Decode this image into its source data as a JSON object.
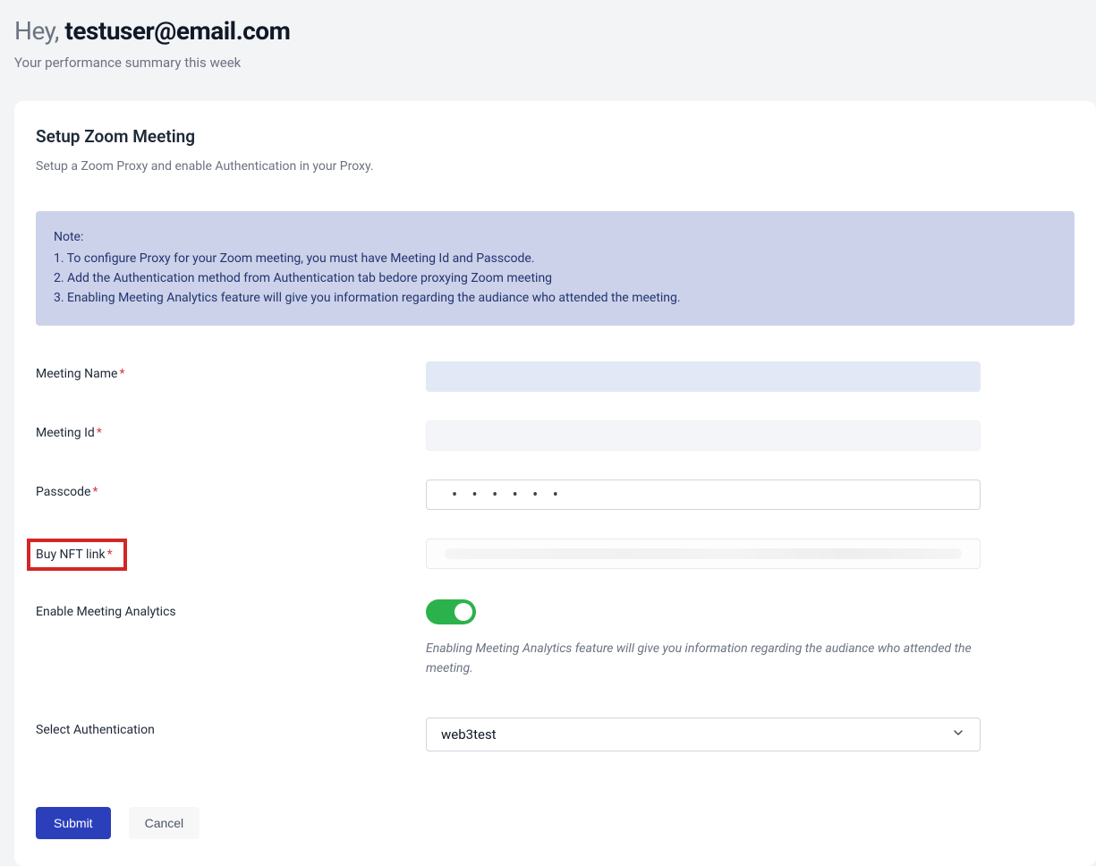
{
  "header": {
    "greeting_prefix": "Hey, ",
    "email": "testuser@email.com",
    "subtitle": "Your performance summary this week"
  },
  "card": {
    "title": "Setup Zoom Meeting",
    "description": "Setup a Zoom Proxy and enable Authentication in your Proxy.",
    "note": {
      "label": "Note:",
      "line1": "1. To configure Proxy for your Zoom meeting, you must have Meeting Id and Passcode.",
      "line2": "2. Add the Authentication method from Authentication tab bedore proxying Zoom meeting",
      "line3": "3. Enabling Meeting Analytics feature will give you information regarding the audiance who attended the meeting."
    }
  },
  "form": {
    "meeting_name_label": "Meeting Name",
    "meeting_name_value": "",
    "meeting_id_label": "Meeting Id",
    "meeting_id_value": "",
    "passcode_label": "Passcode",
    "passcode_mask": "• • • • • •",
    "nft_label": "Buy NFT link",
    "analytics_label": "Enable Meeting Analytics",
    "analytics_on": true,
    "analytics_hint": "Enabling Meeting Analytics feature will give you information regarding the audiance who attended the meeting.",
    "auth_label": "Select Authentication",
    "auth_value": "web3test"
  },
  "actions": {
    "submit": "Submit",
    "cancel": "Cancel"
  }
}
